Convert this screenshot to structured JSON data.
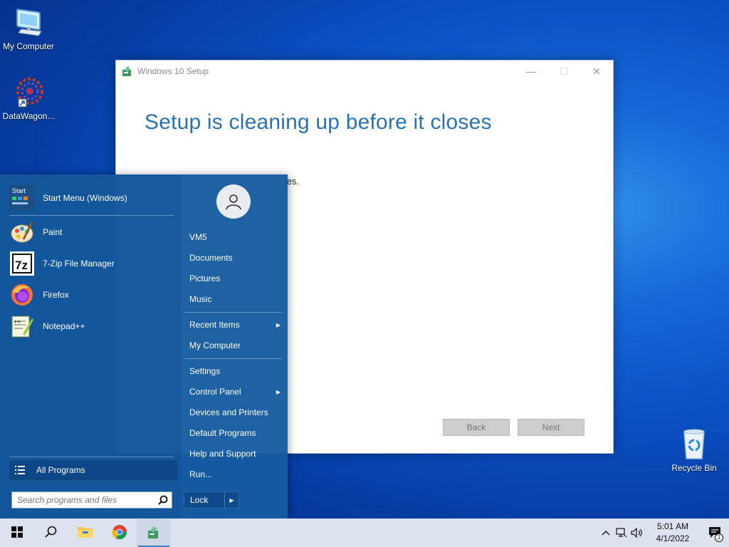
{
  "desktop": {
    "icons": [
      {
        "label": "My Computer",
        "icon": "computer-icon"
      },
      {
        "label": "DataWagon...",
        "icon": "datawagon-icon"
      },
      {
        "label": "Recycle Bin",
        "icon": "recycle-bin-icon"
      }
    ]
  },
  "setup_window": {
    "title": "Windows 10 Setup",
    "heading": "Setup is cleaning up before it closes",
    "subtext_visible": "tes.",
    "back_label": "Back",
    "next_label": "Next",
    "controls": {
      "minimize": "—",
      "maximize": "☐",
      "close": "✕"
    }
  },
  "start_menu": {
    "programs": [
      {
        "label": "Start Menu (Windows)",
        "icon": "start-menu-icon"
      },
      {
        "label": "Paint",
        "icon": "paint-icon"
      },
      {
        "label": "7-Zip File Manager",
        "icon": "7zip-icon"
      },
      {
        "label": "Firefox",
        "icon": "firefox-icon"
      },
      {
        "label": "Notepad++",
        "icon": "notepadpp-icon"
      }
    ],
    "all_programs_label": "All Programs",
    "search_placeholder": "Search programs and files",
    "user_name": "VM5",
    "right_items": [
      {
        "label": "Documents"
      },
      {
        "label": "Pictures"
      },
      {
        "label": "Music"
      },
      {
        "label": "Recent Items",
        "submenu": true
      },
      {
        "label": "My Computer"
      },
      {
        "label": "Settings"
      },
      {
        "label": "Control Panel",
        "submenu": true
      },
      {
        "label": "Devices and Printers"
      },
      {
        "label": "Default Programs"
      },
      {
        "label": "Help and Support"
      },
      {
        "label": "Run..."
      }
    ],
    "lock_label": "Lock"
  },
  "taskbar": {
    "buttons": [
      "windows-start-icon",
      "search-icon",
      "file-explorer-icon",
      "chrome-icon",
      "windows-setup-icon"
    ],
    "active": "windows-setup-icon",
    "clock_time": "5:01 AM",
    "clock_date": "4/1/2022",
    "notification_count": "1"
  },
  "colors": {
    "accent": "#2a72b2",
    "start_menu_bg": "#165ca0",
    "taskbar_bg": "#dde3ee"
  }
}
